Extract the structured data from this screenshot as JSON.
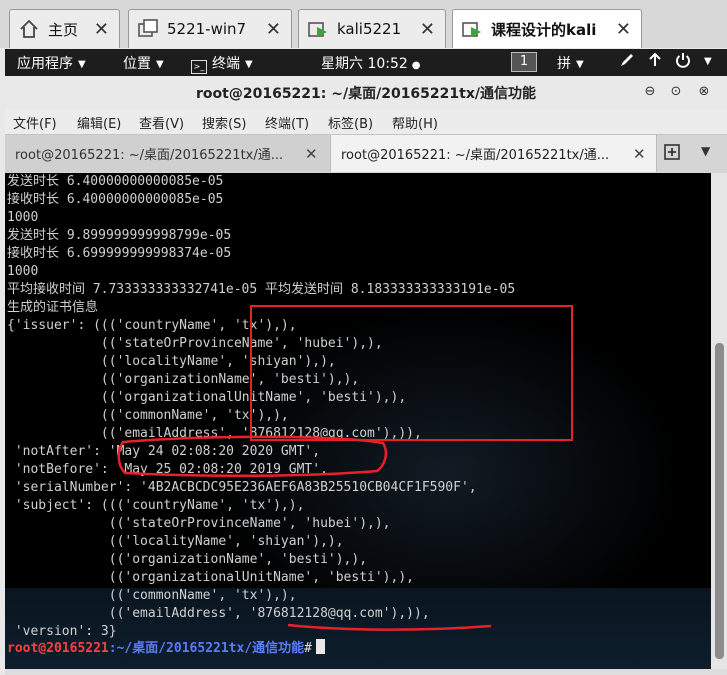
{
  "vm_tabs": [
    {
      "label": "主页",
      "icon": "home-icon",
      "active": false
    },
    {
      "label": "5221-win7",
      "icon": "vm-icon",
      "active": false
    },
    {
      "label": "kali5221",
      "icon": "vm-play-icon",
      "active": false
    },
    {
      "label": "课程设计的kali",
      "icon": "vm-play-icon",
      "active": true
    }
  ],
  "top_bar": {
    "applications": "应用程序",
    "places": "位置",
    "terminal": "终端",
    "clock": "星期六 10:52",
    "workspace": "1",
    "input_method": "拼"
  },
  "window": {
    "title": "root@20165221: ~/桌面/20165221tx/通信功能",
    "menus": [
      "文件(F)",
      "编辑(E)",
      "查看(V)",
      "搜索(S)",
      "终端(T)",
      "标签(B)",
      "帮助(H)"
    ],
    "tabs": [
      {
        "label": "root@20165221: ~/桌面/20165221tx/通...",
        "active": false
      },
      {
        "label": "root@20165221: ~/桌面/20165221tx/通...",
        "active": true
      }
    ]
  },
  "terminal": {
    "lines": [
      "发送时长 6.40000000000085e-05",
      "接收时长 6.40000000000085e-05",
      "1000",
      "发送时长 9.899999999998799e-05",
      "接收时长 6.699999999998374e-05",
      "1000",
      "平均接收时间 7.733333333332741e-05 平均发送时间 8.183333333333191e-05",
      "生成的证书信息",
      "{'issuer': ((('countryName', 'tx'),),",
      "            (('stateOrProvinceName', 'hubei'),),",
      "            (('localityName', 'shiyan'),),",
      "            (('organizationName', 'besti'),),",
      "            (('organizationalUnitName', 'besti'),),",
      "            (('commonName', 'tx'),),",
      "            (('emailAddress', '876812128@qq.com'),)),",
      " 'notAfter': 'May 24 02:08:20 2020 GMT',",
      " 'notBefore': 'May 25 02:08:20 2019 GMT',",
      " 'serialNumber': '4B2ACBCDC95E236AEF6A83B25510CB04CF1F590F',",
      " 'subject': ((('countryName', 'tx'),),",
      "             (('stateOrProvinceName', 'hubei'),),",
      "             (('localityName', 'shiyan'),),",
      "             (('organizationName', 'besti'),),",
      "             (('organizationalUnitName', 'besti'),),",
      "             (('commonName', 'tx'),),",
      "             (('emailAddress', '876812128@qq.com'),)),",
      " 'version': 3}"
    ],
    "prompt": {
      "user_host": "root@20165221",
      "path": ":~/桌面/20165221tx/通信功能",
      "symbol": "#"
    }
  },
  "colors": {
    "annotation": "#e8202a",
    "prompt_user": "#ff4040",
    "prompt_path": "#5b7cff",
    "terminal_bg": "#000000"
  }
}
